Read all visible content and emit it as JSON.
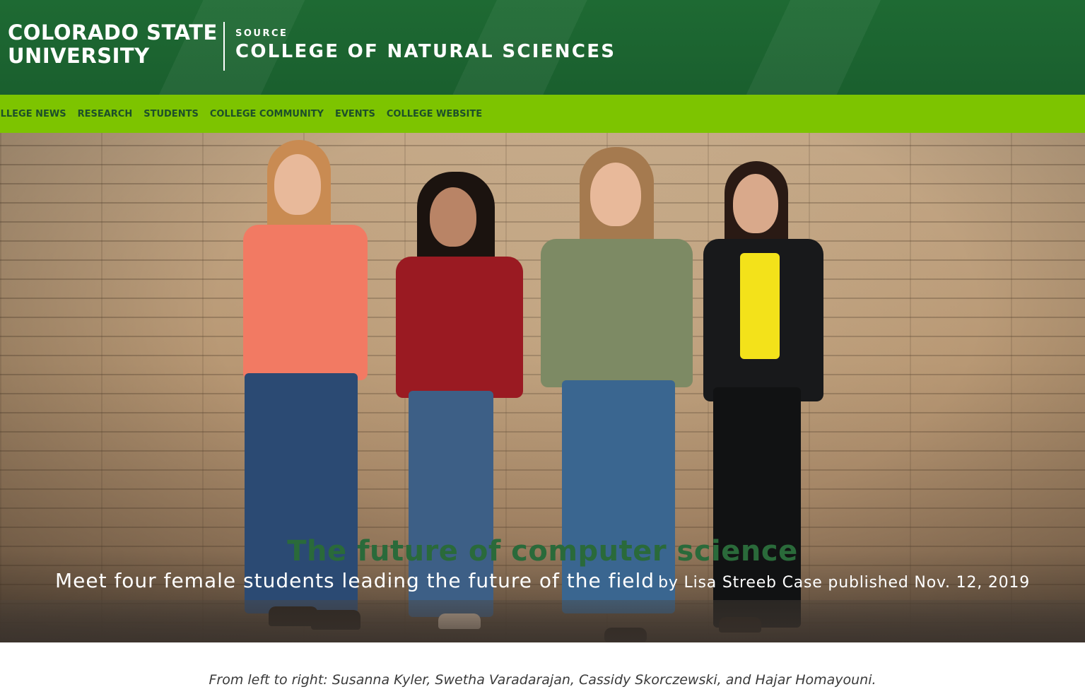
{
  "header": {
    "university_line1": "COLORADO STATE",
    "university_line2": "UNIVERSITY",
    "source_label": "SOURCE",
    "college_title": "COLLEGE OF NATURAL SCIENCES"
  },
  "nav": {
    "items": [
      {
        "label": "COLLEGE NEWS"
      },
      {
        "label": "RESEARCH"
      },
      {
        "label": "STUDENTS"
      },
      {
        "label": "COLLEGE COMMUNITY"
      },
      {
        "label": "EVENTS"
      },
      {
        "label": "COLLEGE WEBSITE"
      }
    ]
  },
  "article": {
    "title": "The future of computer science",
    "subtitle": "Meet four female students leading the future of the field",
    "byline": "by Lisa Streeb Case published Nov. 12, 2019",
    "caption": "From left to right: Susanna Kyler, Swetha Varadarajan, Cassidy Skorczewski, and Hajar Homayouni."
  },
  "colors": {
    "header_green": "#1e6a33",
    "nav_green": "#7dc400",
    "nav_text": "#1d4f2a"
  }
}
